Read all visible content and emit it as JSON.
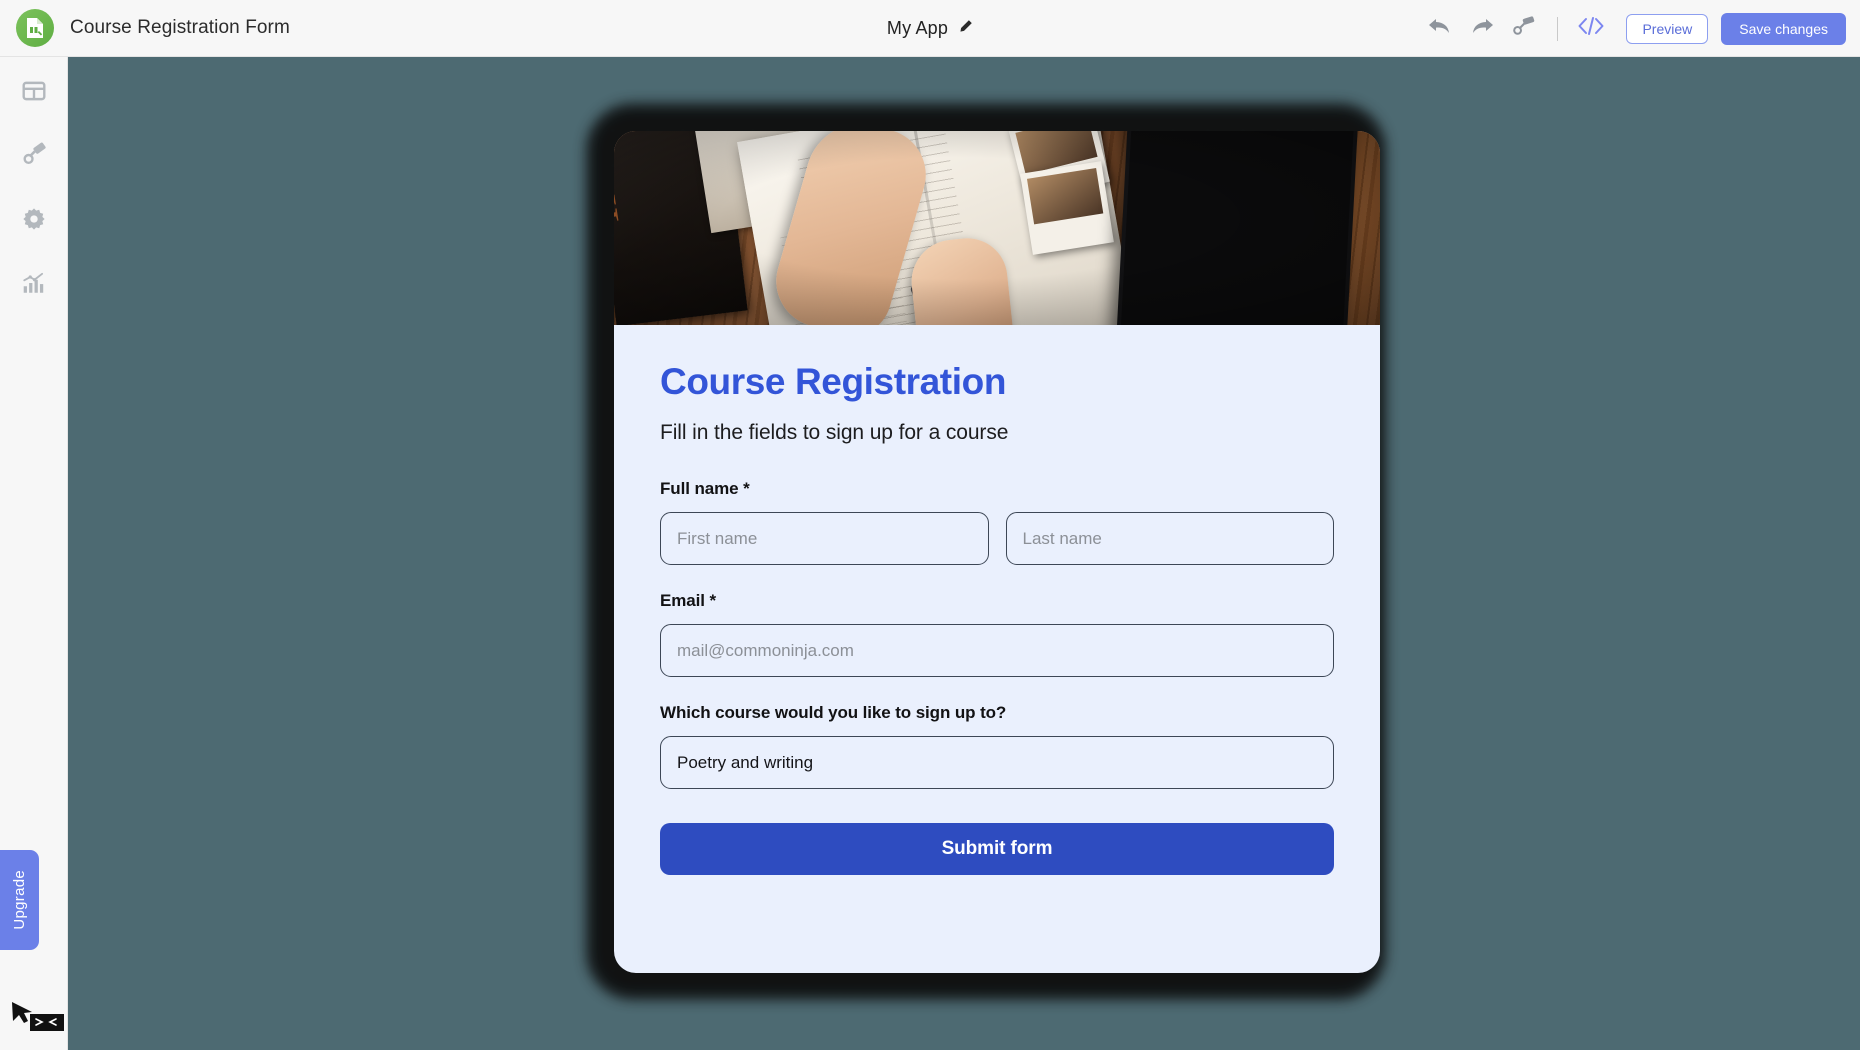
{
  "header": {
    "logo_icon": "form-document-icon",
    "brand_title": "Course Registration Form",
    "app_name": "My App",
    "edit_icon": "pencil-icon",
    "tools": [
      {
        "icon": "undo-icon",
        "name": "undo-button"
      },
      {
        "icon": "redo-icon",
        "name": "redo-button"
      },
      {
        "icon": "paint-roller-icon",
        "name": "style-button"
      },
      {
        "icon": "code-icon",
        "name": "embed-code-button"
      }
    ],
    "preview_label": "Preview",
    "save_label": "Save changes"
  },
  "sidebar": {
    "items": [
      {
        "icon": "layout-grid-icon",
        "name": "sidebar-item-layout"
      },
      {
        "icon": "paintbrush-icon",
        "name": "sidebar-item-design"
      },
      {
        "icon": "gear-icon",
        "name": "sidebar-item-settings"
      },
      {
        "icon": "analytics-chart-icon",
        "name": "sidebar-item-analytics"
      }
    ],
    "upgrade_label": "Upgrade",
    "cursor_icon": "ninja-cursor-icon"
  },
  "form": {
    "hero_image_alt": "hands writing in a journal on a wooden desk with a tablet",
    "title": "Course Registration",
    "subtitle": "Fill in the fields to sign up for a course",
    "fields": [
      {
        "label": "Full name *",
        "inputs": [
          {
            "placeholder": "First name",
            "value": "",
            "name": "first-name-input"
          },
          {
            "placeholder": "Last name",
            "value": "",
            "name": "last-name-input"
          }
        ]
      },
      {
        "label": "Email *",
        "inputs": [
          {
            "placeholder": "mail@commoninja.com",
            "value": "",
            "name": "email-input"
          }
        ]
      }
    ],
    "course_label": "Which course would you like to sign up to?",
    "course_value": "Poetry and writing",
    "submit_label": "Submit form"
  },
  "colors": {
    "canvas_bg": "#4d6a72",
    "form_bg": "#eaf0fd",
    "title_blue": "#3355d8",
    "submit_blue": "#2e4cc0",
    "accent_periwinkle": "#6b80e8",
    "logo_green": "#6ab04c",
    "input_border": "#3d4756"
  }
}
